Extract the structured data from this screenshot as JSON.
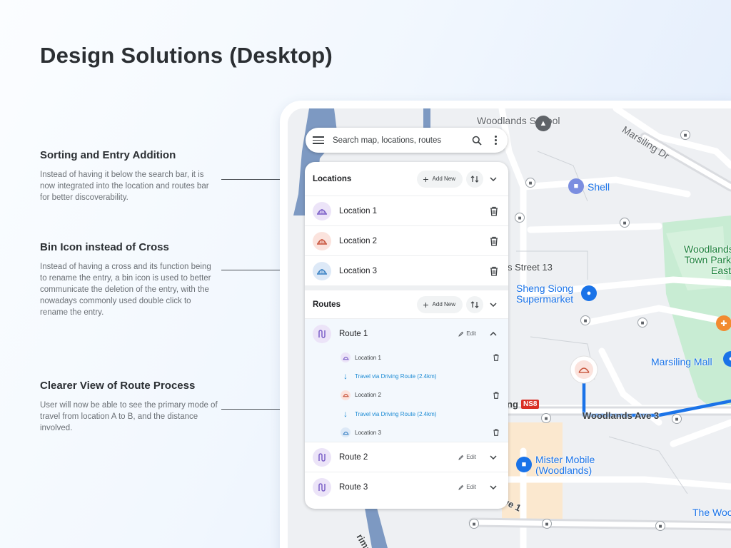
{
  "page": {
    "title": "Design Solutions (Desktop)"
  },
  "annotations": [
    {
      "title": "Sorting and Entry Addition",
      "body": "Instead of having it below the search bar, it is now integrated into the location and routes bar for better discoverability."
    },
    {
      "title": "Bin Icon instead of Cross",
      "body": "Instead of having a cross and its function being to rename the entry, a bin icon is used to better communicate the deletion of the entry, with the nowadays commonly used double click to rename the entry."
    },
    {
      "title": "Clearer View of Route Process",
      "body": "User will now be able to see the primary mode of travel from location A to B, and the distance involved."
    }
  ],
  "search": {
    "placeholder": "Search map, locations, routes"
  },
  "locations": {
    "title": "Locations",
    "add_label": "Add New",
    "items": [
      {
        "label": "Location 1",
        "color": "#7b5fc7",
        "bg": "#ece4f8"
      },
      {
        "label": "Location 2",
        "color": "#c8553d",
        "bg": "#fbe3dd"
      },
      {
        "label": "Location 3",
        "color": "#3b82c4",
        "bg": "#dde9f7"
      }
    ]
  },
  "routes": {
    "title": "Routes",
    "add_label": "Add New",
    "edit_label": "Edit",
    "items": [
      {
        "label": "Route 1",
        "expanded": true,
        "steps": [
          {
            "kind": "location",
            "label": "Location 1"
          },
          {
            "kind": "travel",
            "label": "Travel via Driving Route (2.4km)"
          },
          {
            "kind": "location",
            "label": "Location 2"
          },
          {
            "kind": "travel",
            "label": "Travel via Driving Route (2.4km)"
          },
          {
            "kind": "location",
            "label": "Location 3"
          }
        ]
      },
      {
        "label": "Route 2",
        "expanded": false
      },
      {
        "label": "Route 3",
        "expanded": false
      }
    ]
  },
  "map": {
    "labels": {
      "woodlands_school": "Woodlands School",
      "marsiling_dr": "Marsiling Dr",
      "shell": "Shell",
      "woodlands_town_park": "Woodlands Town Park East",
      "street13": "s Street 13",
      "sheng_siong": "Sheng Siong Supermarket",
      "marsiling_mall": "Marsiling Mall",
      "station_partial": "ng",
      "mrt_code": "NS8",
      "woodlands_ave3": "Woodlands Ave 3",
      "mister_mobile": "Mister Mobile (Woodlands)",
      "the_woo": "The Woo",
      "ave1": "ve 1",
      "rimah": "rimah Ex"
    },
    "accent": "#1a73e8",
    "park": "#c8ecd3"
  }
}
